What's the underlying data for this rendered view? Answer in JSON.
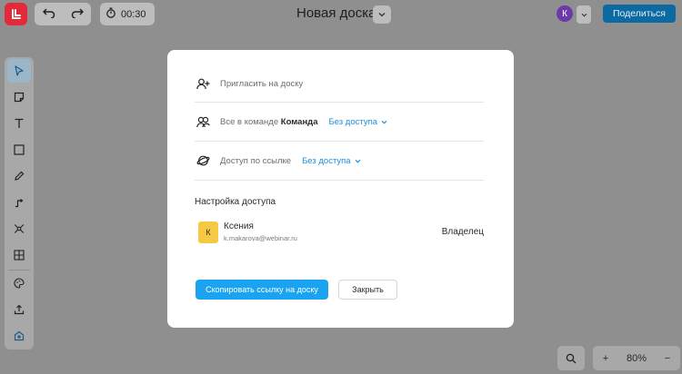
{
  "topbar": {
    "board_title": "Новая доска",
    "timer": "00:30",
    "user_initial": "К",
    "share_label": "Поделиться"
  },
  "toolbar": {
    "tools": [
      "cursor-icon",
      "sticky-note-icon",
      "text-icon",
      "rectangle-icon",
      "pen-icon",
      "connector-icon",
      "mindmap-icon",
      "table-icon",
      "palette-icon",
      "upload-icon",
      "plugins-icon"
    ],
    "active": "cursor-icon"
  },
  "zoom": {
    "plus": "+",
    "value": "80%",
    "minus": "−"
  },
  "modal": {
    "invite_label": "Пригласить на доску",
    "team_prefix": "Все в команде",
    "team_name": "Команда",
    "team_access": "Без доступа",
    "link_label": "Доступ по ссылке",
    "link_access": "Без доступа",
    "section_title": "Настройка доступа",
    "member": {
      "initial": "К",
      "name": "Ксения",
      "email": "k.makarova@webinar.ru",
      "role": "Владелец"
    },
    "copy_label": "Скопировать ссылку на доску",
    "close_label": "Закрыть"
  },
  "colors": {
    "accent": "#1aa3f0",
    "link": "#1a8de0",
    "logo": "#e42a3a",
    "avatar_top": "#6b3aa8",
    "member_avatar": "#f6c945",
    "overlay_bg": "#8f8f8f"
  }
}
